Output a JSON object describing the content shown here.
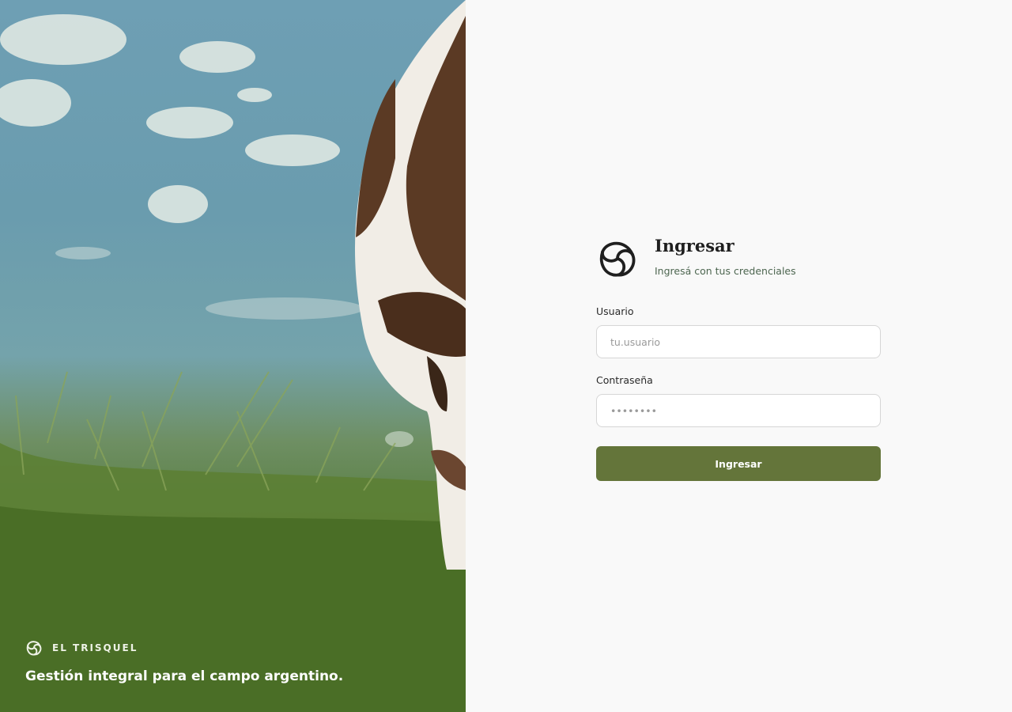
{
  "hero": {
    "brand_name": "EL TRISQUEL",
    "tagline": "Gestión integral para el campo argentino.",
    "logo_icon": "spiral-logo-icon"
  },
  "login": {
    "title": "Ingresar",
    "subtitle": "Ingresá con tus credenciales",
    "logo_icon": "spiral-logo-icon",
    "username_label": "Usuario",
    "username_placeholder": "tu.usuario",
    "password_label": "Contraseña",
    "password_placeholder": "••••••••",
    "submit_label": "Ingresar"
  },
  "colors": {
    "primary": "#64753a",
    "panel_background": "#f9f9f9",
    "title": "#1f1f1f",
    "subtitle": "#4d6650"
  }
}
